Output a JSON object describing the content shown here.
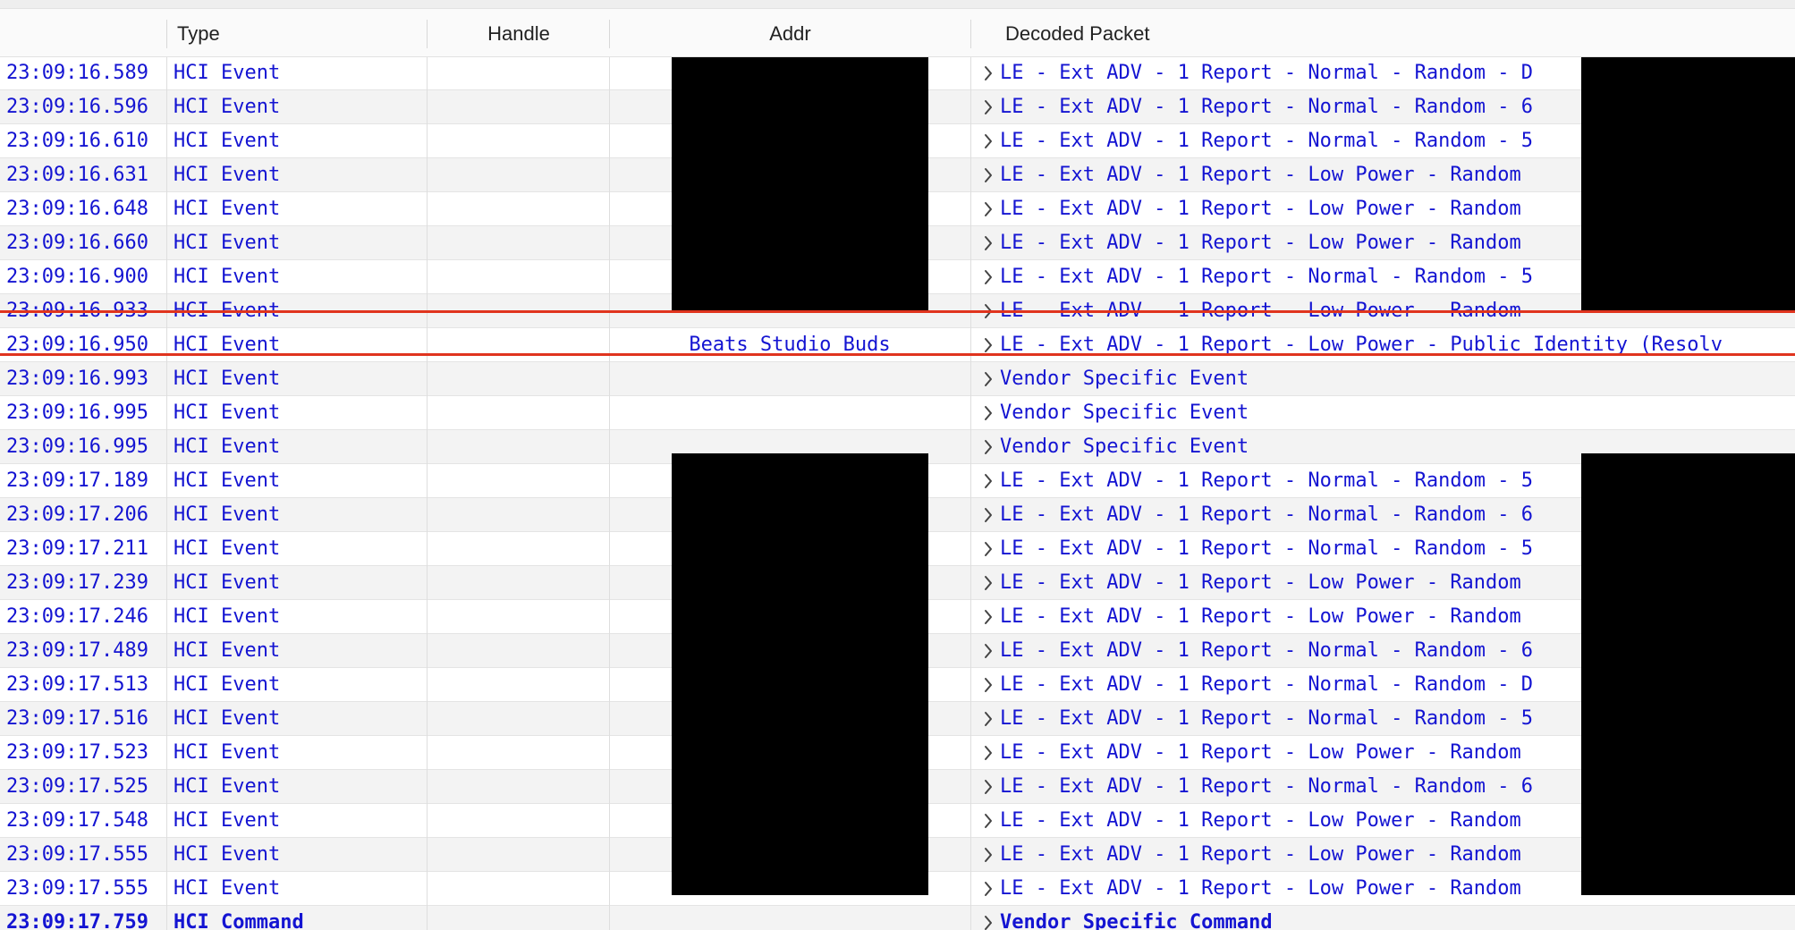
{
  "columns": {
    "type": "Type",
    "handle": "Handle",
    "addr": "Addr",
    "decoded": "Decoded Packet"
  },
  "expand_icon": "chevron-right-icon",
  "colors": {
    "text": "#1414d2",
    "selection_border": "#e0341e",
    "redaction": "#000000"
  },
  "rows": [
    {
      "time": "23:09:16.589",
      "type": "HCI Event",
      "handle": "",
      "addr": "",
      "decoded": "LE - Ext ADV - 1 Report - Normal - Random - D"
    },
    {
      "time": "23:09:16.596",
      "type": "HCI Event",
      "handle": "",
      "addr": "",
      "decoded": "LE - Ext ADV - 1 Report - Normal - Random - 6"
    },
    {
      "time": "23:09:16.610",
      "type": "HCI Event",
      "handle": "",
      "addr": "",
      "decoded": "LE - Ext ADV - 1 Report - Normal - Random - 5"
    },
    {
      "time": "23:09:16.631",
      "type": "HCI Event",
      "handle": "",
      "addr": "",
      "decoded": "LE - Ext ADV - 1 Report - Low Power - Random"
    },
    {
      "time": "23:09:16.648",
      "type": "HCI Event",
      "handle": "",
      "addr": "",
      "decoded": "LE - Ext ADV - 1 Report - Low Power - Random"
    },
    {
      "time": "23:09:16.660",
      "type": "HCI Event",
      "handle": "",
      "addr": "",
      "decoded": "LE - Ext ADV - 1 Report - Low Power - Random"
    },
    {
      "time": "23:09:16.900",
      "type": "HCI Event",
      "handle": "",
      "addr": "",
      "decoded": "LE - Ext ADV - 1 Report - Normal - Random - 5"
    },
    {
      "time": "23:09:16.933",
      "type": "HCI Event",
      "handle": "",
      "addr": "",
      "decoded": "LE - Ext ADV - 1 Report - Low Power - Random"
    },
    {
      "time": "23:09:16.950",
      "type": "HCI Event",
      "handle": "",
      "addr": "Beats Studio Buds",
      "decoded": "LE - Ext ADV - 1 Report - Low Power - Public Identity (Resolv",
      "selected": true
    },
    {
      "time": "23:09:16.993",
      "type": "HCI Event",
      "handle": "",
      "addr": "",
      "decoded": "Vendor Specific Event"
    },
    {
      "time": "23:09:16.995",
      "type": "HCI Event",
      "handle": "",
      "addr": "",
      "decoded": "Vendor Specific Event"
    },
    {
      "time": "23:09:16.995",
      "type": "HCI Event",
      "handle": "",
      "addr": "",
      "decoded": "Vendor Specific Event"
    },
    {
      "time": "23:09:17.189",
      "type": "HCI Event",
      "handle": "",
      "addr": "",
      "decoded": "LE - Ext ADV - 1 Report - Normal - Random - 5"
    },
    {
      "time": "23:09:17.206",
      "type": "HCI Event",
      "handle": "",
      "addr": "",
      "decoded": "LE - Ext ADV - 1 Report - Normal - Random - 6"
    },
    {
      "time": "23:09:17.211",
      "type": "HCI Event",
      "handle": "",
      "addr": "",
      "decoded": "LE - Ext ADV - 1 Report - Normal - Random - 5"
    },
    {
      "time": "23:09:17.239",
      "type": "HCI Event",
      "handle": "",
      "addr": "",
      "decoded": "LE - Ext ADV - 1 Report - Low Power - Random"
    },
    {
      "time": "23:09:17.246",
      "type": "HCI Event",
      "handle": "",
      "addr": "",
      "decoded": "LE - Ext ADV - 1 Report - Low Power - Random"
    },
    {
      "time": "23:09:17.489",
      "type": "HCI Event",
      "handle": "",
      "addr": "",
      "decoded": "LE - Ext ADV - 1 Report - Normal - Random - 6"
    },
    {
      "time": "23:09:17.513",
      "type": "HCI Event",
      "handle": "",
      "addr": "",
      "decoded": "LE - Ext ADV - 1 Report - Normal - Random - D"
    },
    {
      "time": "23:09:17.516",
      "type": "HCI Event",
      "handle": "",
      "addr": "",
      "decoded": "LE - Ext ADV - 1 Report - Normal - Random - 5"
    },
    {
      "time": "23:09:17.523",
      "type": "HCI Event",
      "handle": "",
      "addr": "",
      "decoded": "LE - Ext ADV - 1 Report - Low Power - Random"
    },
    {
      "time": "23:09:17.525",
      "type": "HCI Event",
      "handle": "",
      "addr": "",
      "decoded": "LE - Ext ADV - 1 Report - Normal - Random - 6"
    },
    {
      "time": "23:09:17.548",
      "type": "HCI Event",
      "handle": "",
      "addr": "",
      "decoded": "LE - Ext ADV - 1 Report - Low Power - Random"
    },
    {
      "time": "23:09:17.555",
      "type": "HCI Event",
      "handle": "",
      "addr": "",
      "decoded": "LE - Ext ADV - 1 Report - Low Power - Random"
    },
    {
      "time": "23:09:17.555",
      "type": "HCI Event",
      "handle": "",
      "addr": "",
      "decoded": "LE - Ext ADV - 1 Report - Low Power - Random"
    },
    {
      "time": "23:09:17.759",
      "type": "HCI Command",
      "handle": "",
      "addr": "",
      "decoded": "Vendor Specific Command",
      "bold": true
    }
  ]
}
